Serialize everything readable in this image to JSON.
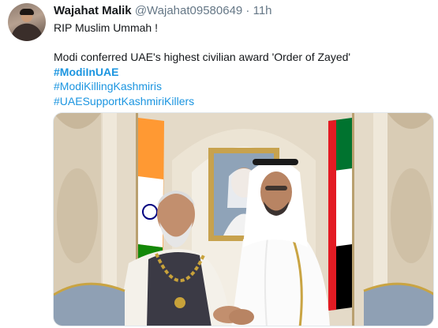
{
  "tweet": {
    "author_name": "Wajahat Malik",
    "handle": "@Wajahat09580649",
    "separator": "·",
    "time": "11h",
    "line1": "RIP Muslim Ummah !",
    "line2": "Modi conferred UAE's highest civilian award 'Order of Zayed'",
    "hashtags": [
      "#ModiInUAE",
      "#ModiKillingKashmiris",
      "#UAESupportKashmiriKillers"
    ]
  }
}
